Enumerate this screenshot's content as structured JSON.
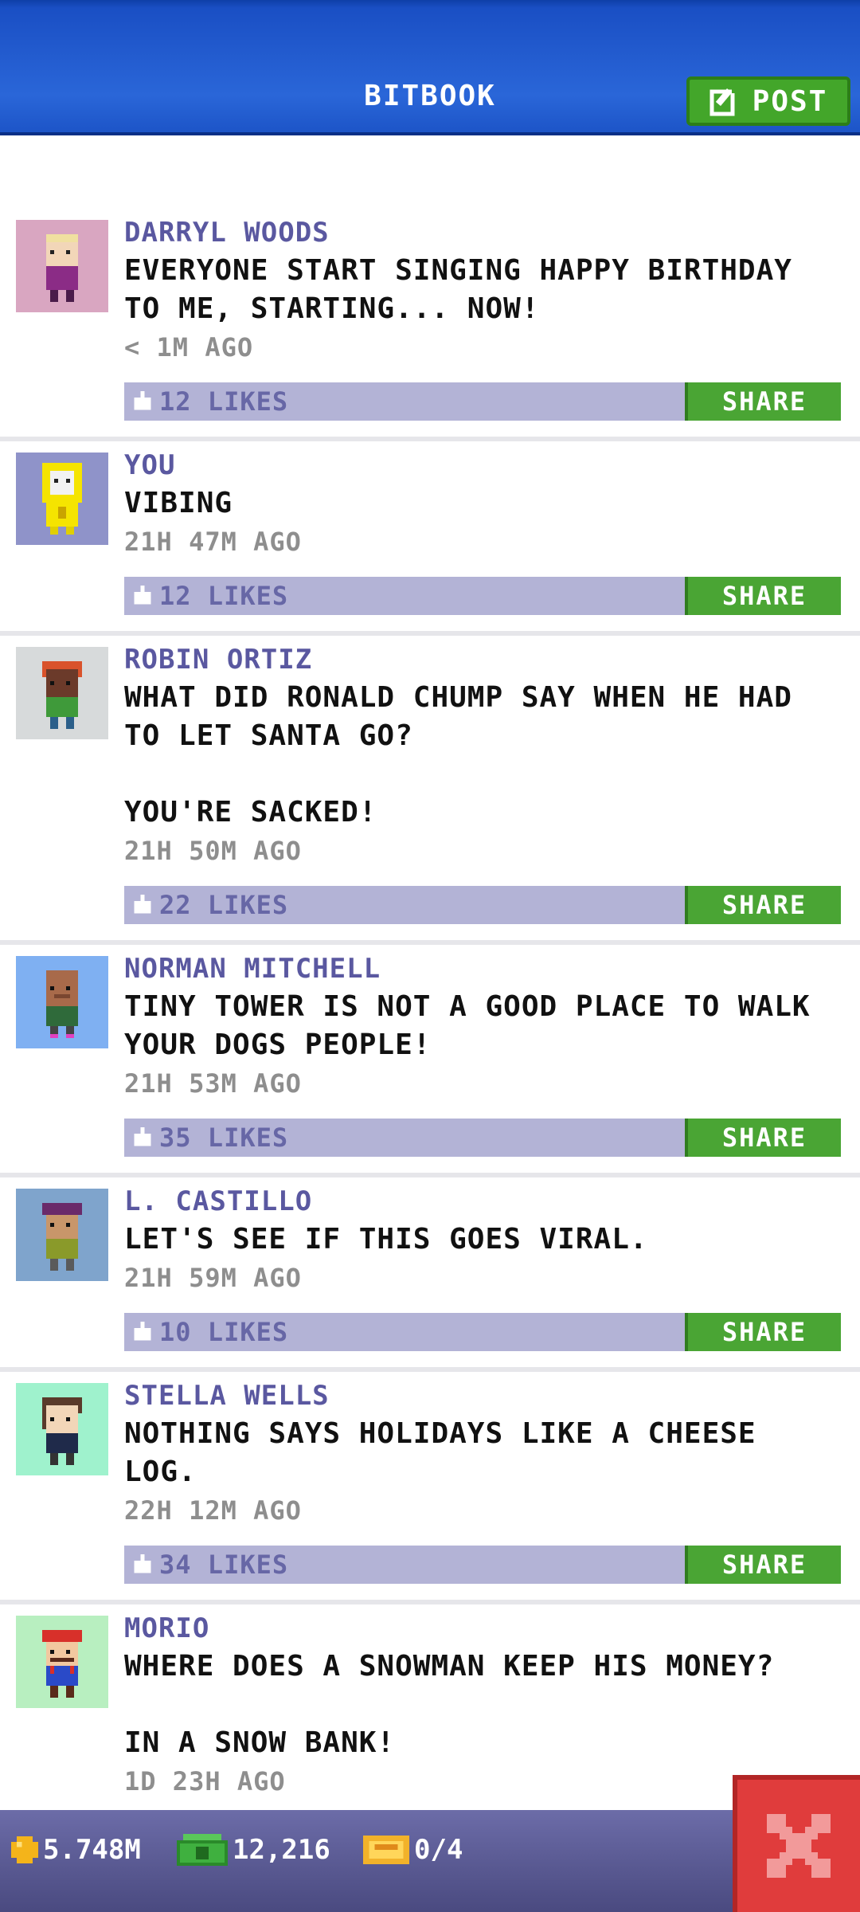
{
  "header": {
    "title": "BITBOOK",
    "post_label": "POST"
  },
  "colors": {
    "header_blue": "#1a4fc4",
    "author": "#5a58a0",
    "share_green": "#4aa534",
    "likes_bar": "#b3b3d6",
    "close_red": "#e03c3c"
  },
  "posts": [
    {
      "author": "DARRYL WOODS",
      "message": "EVERYONE START SINGING HAPPY BIRTHDAY\nTO ME, STARTING... NOW!",
      "time": "< 1M AGO",
      "likes": "12 LIKES",
      "share": "SHARE",
      "avatar_bg": "#d9a6c1",
      "avatar_icon": "avatar-blonde-purple-icon"
    },
    {
      "author": "YOU",
      "message": "VIBING",
      "time": "21H 47M AGO",
      "likes": "12 LIKES",
      "share": "SHARE",
      "avatar_bg": "#8f93c9",
      "avatar_icon": "avatar-yellow-hazmat-icon"
    },
    {
      "author": "ROBIN ORTIZ",
      "message": "WHAT DID RONALD CHUMP SAY WHEN HE HAD\nTO LET SANTA GO?\n\nYOU'RE SACKED!",
      "time": "21H 50M AGO",
      "likes": "22 LIKES",
      "share": "SHARE",
      "avatar_bg": "#d7dadb",
      "avatar_icon": "avatar-redhead-icon"
    },
    {
      "author": "NORMAN MITCHELL",
      "message": "TINY TOWER IS NOT A GOOD PLACE TO WALK\nYOUR DOGS PEOPLE!",
      "time": "21H 53M AGO",
      "likes": "35 LIKES",
      "share": "SHARE",
      "avatar_bg": "#7fb0f2",
      "avatar_icon": "avatar-bald-green-icon"
    },
    {
      "author": "L. CASTILLO",
      "message": "LET'S SEE IF THIS GOES VIRAL.",
      "time": "21H 59M AGO",
      "likes": "10 LIKES",
      "share": "SHARE",
      "avatar_bg": "#7fa4cc",
      "avatar_icon": "avatar-purple-cap-icon"
    },
    {
      "author": "STELLA WELLS",
      "message": "NOTHING SAYS HOLIDAYS LIKE A CHEESE\nLOG.",
      "time": "22H 12M AGO",
      "likes": "34 LIKES",
      "share": "SHARE",
      "avatar_bg": "#9ff2cd",
      "avatar_icon": "avatar-brown-hair-icon"
    },
    {
      "author": "MORIO",
      "message": "WHERE DOES A SNOWMAN KEEP HIS MONEY?\n\nIN A SNOW BANK!",
      "time": "1D 23H AGO",
      "likes": "",
      "share": "",
      "avatar_bg": "#b8efc0",
      "avatar_icon": "avatar-red-cap-plumber-icon"
    }
  ],
  "footer": {
    "coins": "5.748M",
    "bux": "12,216",
    "tickets": "0/4"
  }
}
